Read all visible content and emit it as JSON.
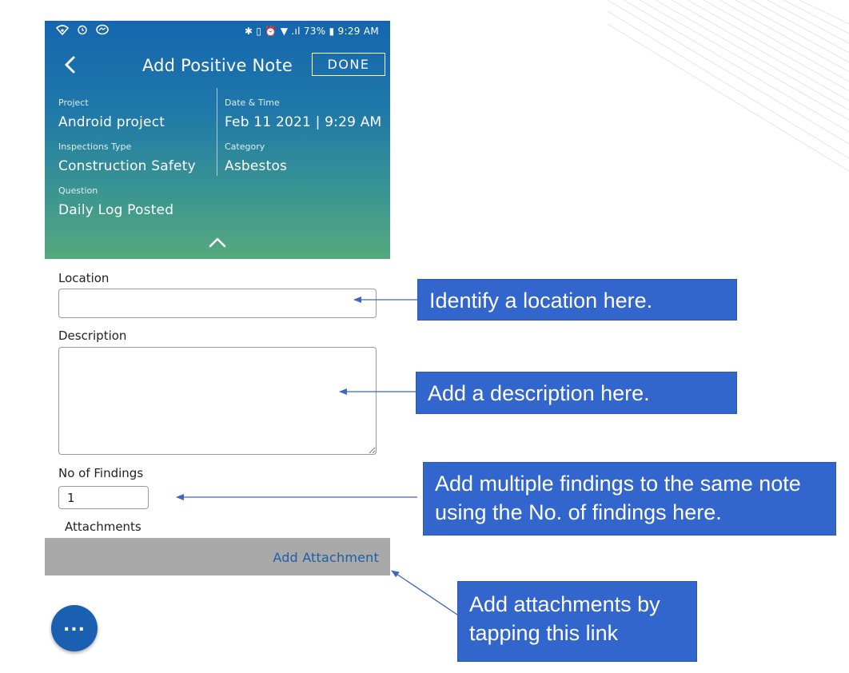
{
  "status_bar": {
    "right_text": "✱ ▯ ⏰ ▼ .ıl 73% ▮ 9:29 AM",
    "left_icons": [
      "signal-wifi-icon",
      "alarm-icon",
      "messenger-icon"
    ]
  },
  "header": {
    "title": "Add Positive Note",
    "done_label": "DONE"
  },
  "details": {
    "project_label": "Project",
    "project_value": "Android project",
    "datetime_label": "Date & Time",
    "datetime_value": "Feb 11 2021 | 9:29 AM",
    "inspection_type_label": "Inspections Type",
    "inspection_type_value": "Construction Safety",
    "category_label": "Category",
    "category_value": "Asbestos",
    "question_label": "Question",
    "question_value": "Daily Log Posted"
  },
  "form": {
    "location_label": "Location",
    "location_value": "",
    "description_label": "Description",
    "description_value": "",
    "findings_label": "No of Findings",
    "findings_value": "1",
    "attachments_label": "Attachments",
    "add_attachment_label": "Add Attachment"
  },
  "fab": {
    "label": "..."
  },
  "callouts": {
    "location": "Identify a location here.",
    "description": "Add a description here.",
    "findings": "Add multiple findings to the same note using the No. of findings here.",
    "attach": "Add attachments by tapping this link"
  },
  "colors": {
    "header_top": "#1566ae",
    "header_bottom": "#56a97c",
    "callout": "#3366cc",
    "link": "#1d5ea8",
    "attach_bar": "#a9a9a9"
  }
}
